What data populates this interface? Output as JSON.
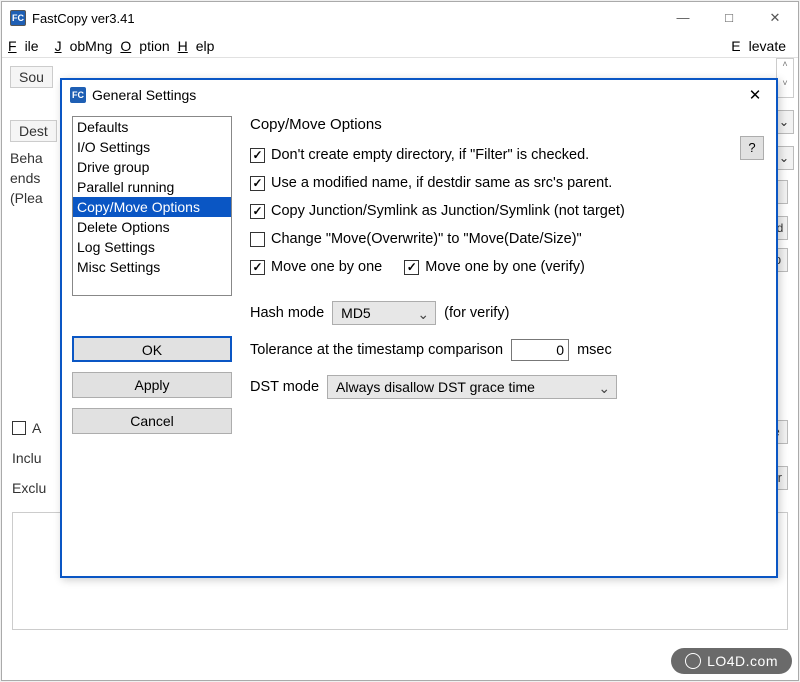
{
  "window": {
    "title": "FastCopy ver3.41",
    "app_icon_text": "FC",
    "minimize": "—",
    "maximize": "□",
    "close": "✕"
  },
  "menubar": {
    "file": "File",
    "jobmng": "JobMng",
    "option": "Option",
    "help": "Help",
    "elevate": "Elevate"
  },
  "main_bg": {
    "source_label": "Sou",
    "dest_label": "Dest",
    "behavior_line1": "Beha",
    "behavior_line2": "ends",
    "behavior_line3": "(Plea",
    "qmark": "?",
    "speed": "peed",
    "top": "Top",
    "ute": "ute",
    "filter": "Filter",
    "acl_check": "A",
    "include": "Inclu",
    "exclude": "Exclu"
  },
  "modal": {
    "title": "General Settings",
    "icon_text": "FC",
    "close": "✕",
    "list": [
      "Defaults",
      "I/O Settings",
      "Drive group",
      "Parallel running",
      "Copy/Move Options",
      "Delete Options",
      "Log Settings",
      "Misc Settings"
    ],
    "selected_index": 4,
    "buttons": {
      "ok": "OK",
      "apply": "Apply",
      "cancel": "Cancel"
    }
  },
  "panel": {
    "heading": "Copy/Move Options",
    "help": "?",
    "cb1": {
      "label": "Don't create empty directory, if \"Filter\" is checked.",
      "checked": true
    },
    "cb2": {
      "label": "Use a modified name, if destdir same as src's parent.",
      "checked": true
    },
    "cb3": {
      "label": "Copy Junction/Symlink as Junction/Symlink (not target)",
      "checked": true
    },
    "cb4": {
      "label": "Change \"Move(Overwrite)\" to \"Move(Date/Size)\"",
      "checked": false
    },
    "cb5": {
      "label": "Move one by one",
      "checked": true
    },
    "cb6": {
      "label": "Move one by one (verify)",
      "checked": true
    },
    "hash_label": "Hash mode",
    "hash_value": "MD5",
    "hash_suffix": "(for verify)",
    "tolerance_label": "Tolerance at the timestamp comparison",
    "tolerance_value": "0",
    "tolerance_suffix": "msec",
    "dst_label": "DST mode",
    "dst_value": "Always disallow DST grace time"
  },
  "watermark": "LO4D.com"
}
